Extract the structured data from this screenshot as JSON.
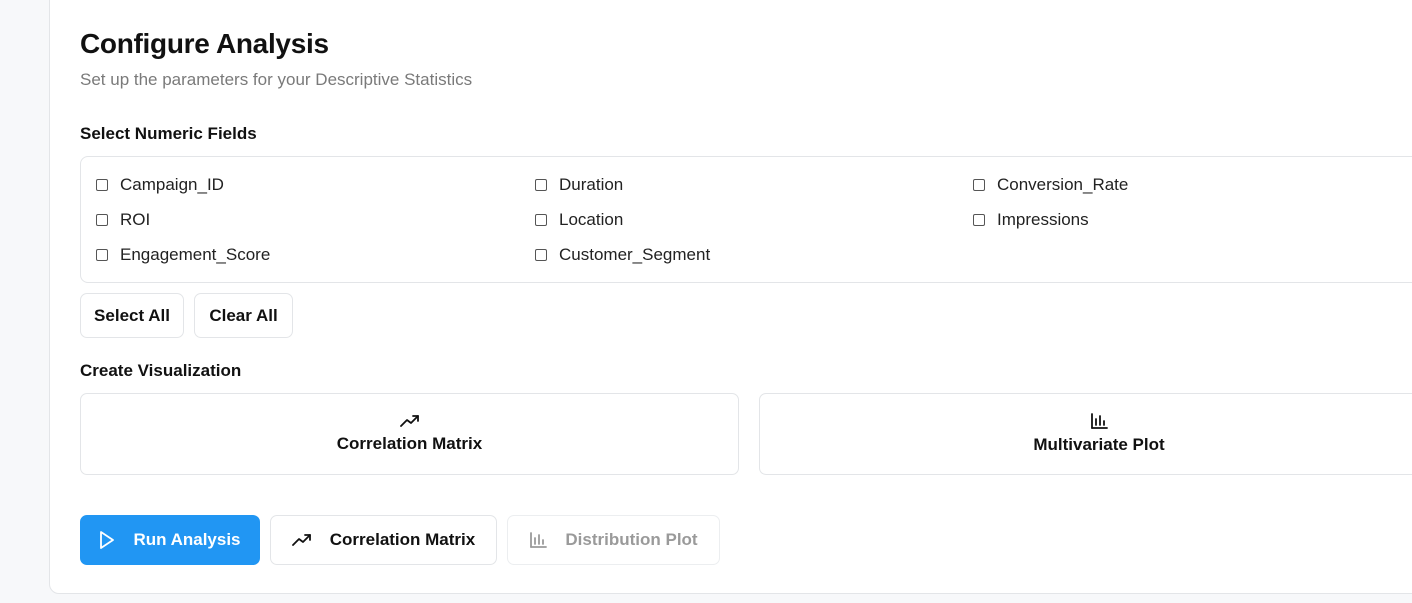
{
  "header": {
    "title": "Configure Analysis",
    "subtitle": "Set up the parameters for your Descriptive Statistics"
  },
  "numeric_fields": {
    "label": "Select Numeric Fields",
    "fields": [
      {
        "name": "Campaign_ID",
        "checked": false
      },
      {
        "name": "Duration",
        "checked": false
      },
      {
        "name": "Conversion_Rate",
        "checked": false
      },
      {
        "name": "ROI",
        "checked": false
      },
      {
        "name": "Location",
        "checked": false
      },
      {
        "name": "Impressions",
        "checked": false
      },
      {
        "name": "Engagement_Score",
        "checked": false
      },
      {
        "name": "Customer_Segment",
        "checked": false
      }
    ],
    "select_all_label": "Select All",
    "clear_all_label": "Clear All"
  },
  "visualization": {
    "label": "Create Visualization",
    "options": [
      {
        "label": "Correlation Matrix",
        "icon": "trending-up-icon"
      },
      {
        "label": "Multivariate Plot",
        "icon": "bar-chart-icon"
      }
    ]
  },
  "actions": {
    "run_label": "Run Analysis",
    "run_icon": "play-icon",
    "correlation_label": "Correlation Matrix",
    "correlation_icon": "trending-up-icon",
    "distribution_label": "Distribution Plot",
    "distribution_icon": "bar-chart-icon",
    "distribution_disabled": true
  },
  "colors": {
    "primary": "#2196f3",
    "border": "#e3e5e8",
    "muted_text": "#7a7a7a",
    "disabled_text": "#9a9a9a"
  }
}
